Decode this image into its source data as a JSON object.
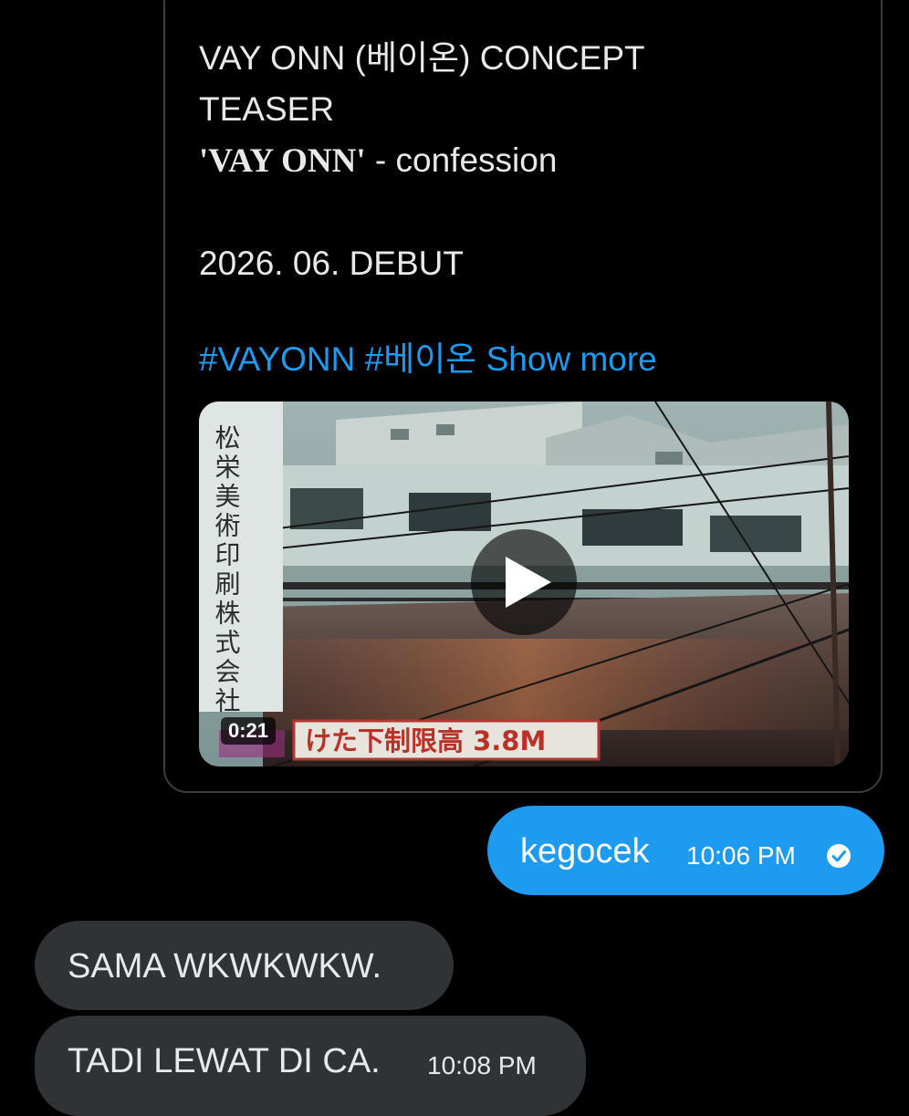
{
  "shared_post": {
    "title_line1": "VAY ONN (베이온) CONCEPT",
    "title_line2": "TEASER",
    "title_line3_name": "'VAY ONN'",
    "title_line3_rest": " - confession",
    "debut_line": "2026. 06. DEBUT",
    "hashtags": [
      "#VAYONN",
      "#베이온"
    ],
    "show_more_label": "Show more",
    "video": {
      "duration": "0:21",
      "vertical_sign_text": "松栄美術印刷株式会社",
      "bottom_sign_text": "けた下制限高 3.8M"
    }
  },
  "messages": [
    {
      "direction": "sent",
      "text": "kegocek",
      "time": "10:06 PM",
      "status_icon": "check-circle-icon"
    },
    {
      "direction": "received",
      "text": "SAMA WKWKWKW.",
      "time": ""
    },
    {
      "direction": "received",
      "text": "TADI LEWAT DI CA.",
      "time": "10:08 PM"
    }
  ],
  "colors": {
    "background": "#000000",
    "accent": "#1d9bf0",
    "received_bubble": "#2f3336",
    "text": "#e7e9ea"
  }
}
